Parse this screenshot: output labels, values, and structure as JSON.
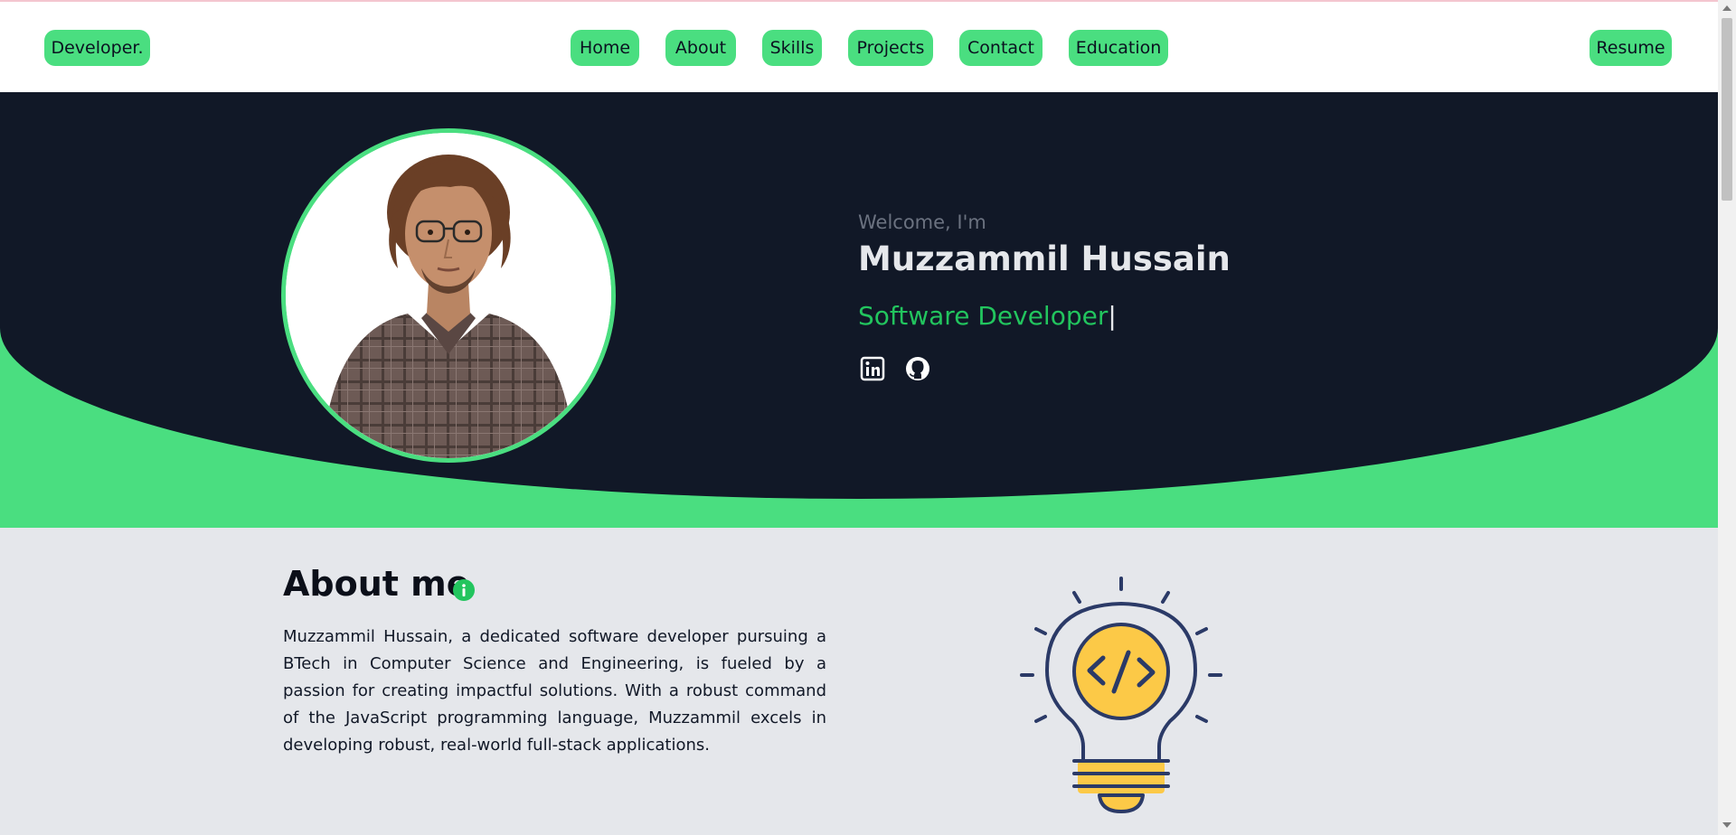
{
  "nav": {
    "brand": "Developer.",
    "items": [
      "Home",
      "About",
      "Skills",
      "Projects",
      "Contact",
      "Education"
    ],
    "resume": "Resume"
  },
  "hero": {
    "welcome": "Welcome, I'm",
    "name": "Muzzammil Hussain",
    "role": "Software Developer",
    "cursor": "|",
    "socials": [
      "linkedin-icon",
      "github-icon"
    ]
  },
  "about": {
    "title": "About me",
    "paragraph": "Muzzammil Hussain, a dedicated software developer pursuing a BTech in Computer Science and Engineering, is fueled by a passion for creating impactful solutions. With a robust command of the JavaScript programming language, Muzzammil excels in developing robust, real-world full-stack applications.",
    "illustration": "lightbulb-code-icon"
  },
  "colors": {
    "accent": "#4ade80",
    "accent_text": "#22c55e",
    "hero_bg": "#111827",
    "page_bg": "#e5e7eb",
    "bulb_fill": "#fcc947",
    "bulb_stroke": "#2b3a67"
  }
}
